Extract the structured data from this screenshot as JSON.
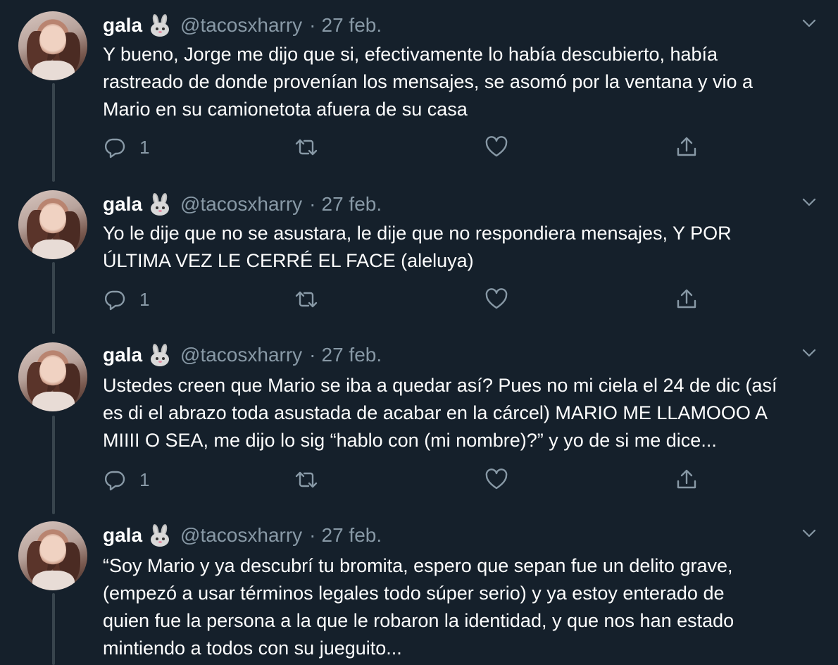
{
  "tweets": [
    {
      "name": "gala",
      "handle": "@tacosxharry",
      "separator": "·",
      "date": "27 feb.",
      "text": "Y bueno, Jorge me dijo que si, efectivamente lo había descubierto, había\nrastreado de donde provenían los mensajes, se asomó por la ventana y vio a\nMario en su camionetota afuera de su casa",
      "reply_count": "1"
    },
    {
      "name": "gala",
      "handle": "@tacosxharry",
      "separator": "·",
      "date": "27 feb.",
      "text": "Yo le dije que no se asustara, le dije que no respondiera mensajes, Y POR\nÚLTIMA VEZ LE CERRÉ EL FACE (aleluya)",
      "reply_count": "1"
    },
    {
      "name": "gala",
      "handle": "@tacosxharry",
      "separator": "·",
      "date": "27 feb.",
      "text": "Ustedes creen que Mario se iba a quedar así? Pues no mi ciela el 24 de dic (así\nes di el abrazo toda asustada de acabar en la cárcel) MARIO ME LLAMOOO A\nMIIII O SEA, me dijo lo sig “hablo con (mi nombre)?” y yo de si me dice...",
      "reply_count": "1"
    },
    {
      "name": "gala",
      "handle": "@tacosxharry",
      "separator": "·",
      "date": "27 feb.",
      "text": "“Soy Mario y ya descubrí tu bromita, espero que sepan fue un delito grave,\n(empezó a usar términos legales todo súper serio) y ya estoy enterado de\nquien fue la persona a la que le robaron la identidad, y que nos han estado\nmintiendo a todos con su jueguito...",
      "reply_count": ""
    }
  ],
  "icons": {
    "emoji": "rabbit-face-icon",
    "caret": "chevron-down-icon",
    "reply": "reply-icon",
    "retweet": "retweet-icon",
    "like": "heart-icon",
    "share": "share-icon"
  },
  "colors": {
    "background": "#15202b",
    "muted": "#8899a6",
    "thread_line": "#38444d"
  }
}
